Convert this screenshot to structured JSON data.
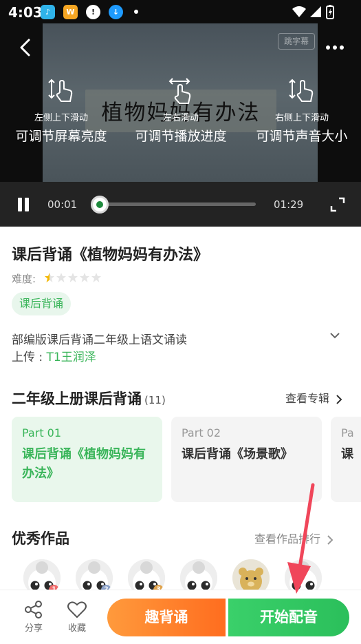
{
  "status_bar": {
    "time": "4:03",
    "apps": [
      {
        "name": "qq-music-icon",
        "text": "♪",
        "color": "#29a7e1"
      },
      {
        "name": "app-orange-icon",
        "text": "W",
        "color": "#f5a623"
      },
      {
        "name": "alert-icon",
        "text": "!",
        "color": "#ffffff"
      },
      {
        "name": "download-icon",
        "text": "↓",
        "color": "#1e9bff"
      }
    ]
  },
  "video": {
    "frame_title": "植物妈妈有办法",
    "frame_badge": "跳字幕",
    "gestures": [
      {
        "small": "左侧上下滑动",
        "big": "可调节屏幕亮度"
      },
      {
        "small": "左右滑动",
        "big": "可调节播放进度"
      },
      {
        "small": "右侧上下滑动",
        "big": "可调节声音大小"
      }
    ],
    "current_time": "00:01",
    "total_time": "01:29",
    "progress": 0.0
  },
  "info": {
    "title": "课后背诵《植物妈妈有办法》",
    "difficulty_label": "难度:",
    "difficulty_rating": 0.5,
    "difficulty_max": 5,
    "tag": "课后背诵",
    "description": "部编版课后背诵二年级上语文诵读",
    "uploader_label": "上传 : ",
    "uploader_name": "T1王润泽"
  },
  "album": {
    "title": "二年级上册课后背诵",
    "count": "(11)",
    "link": "查看专辑",
    "parts": [
      {
        "no": "Part 01",
        "title": "课后背诵《植物妈妈有办法》",
        "active": true
      },
      {
        "no": "Part 02",
        "title": "课后背诵《场景歌》",
        "active": false
      },
      {
        "no": "Pa",
        "title": "课",
        "active": false
      }
    ]
  },
  "works": {
    "title": "优秀作品",
    "link": "查看作品排行",
    "avatars": [
      {
        "rank": "1",
        "rank_color": "#f06a6a"
      },
      {
        "rank": "2",
        "rank_color": "#8aa0c8"
      },
      {
        "rank": "3",
        "rank_color": "#e0a24a"
      },
      {
        "rank": "",
        "rank_color": ""
      },
      {
        "rank": "",
        "rank_color": ""
      },
      {
        "rank": "",
        "rank_color": ""
      }
    ]
  },
  "bottom": {
    "share": "分享",
    "favorite": "收藏",
    "fun_recite": "趣背诵",
    "start_dub": "开始配音"
  },
  "colors": {
    "accent_green": "#3ab55a",
    "accent_orange": "#ff7a24",
    "annotation_red": "#f0465a"
  }
}
